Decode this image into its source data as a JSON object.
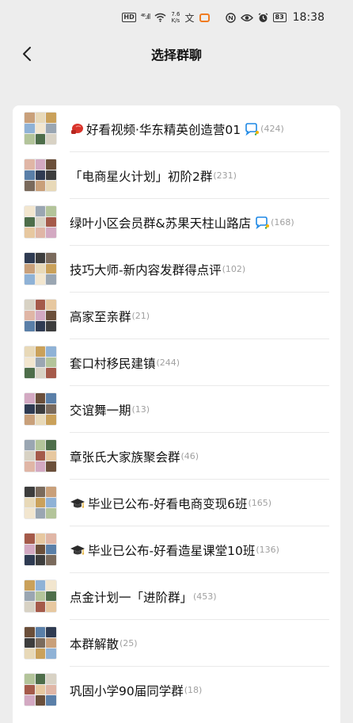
{
  "status_bar": {
    "hd": "HD",
    "signal": "⁴⁶.ıll",
    "speed_value": "7.6",
    "speed_unit": "K/s",
    "battery": "83",
    "time": "18:38"
  },
  "header": {
    "title": "选择群聊",
    "back_icon": "chevron-left-icon"
  },
  "groups": [
    {
      "name": "好看视频·华东精英创造营01",
      "count": "(424)",
      "prefix_icon": "boxing-glove-icon",
      "suffix_icon": "chat-bubble-icon"
    },
    {
      "name": "「电商星火计划」初阶2群",
      "count": "(231)"
    },
    {
      "name": "绿叶小区会员群&苏果天柱山路店",
      "count": "(168)",
      "suffix_icon": "chat-bubble-icon"
    },
    {
      "name": "技巧大师-新内容发群得点评",
      "count": "(102)"
    },
    {
      "name": "高家至亲群",
      "count": "(21)"
    },
    {
      "name": "套口村移民建镇",
      "count": "(244)"
    },
    {
      "name": "交谊舞一期",
      "count": "(13)"
    },
    {
      "name": "章张氏大家族聚会群",
      "count": "(46)"
    },
    {
      "name": "毕业已公布-好看电商变现6班",
      "count": "(165)",
      "prefix_icon": "graduation-cap-icon"
    },
    {
      "name": "毕业已公布-好看造星课堂10班",
      "count": "(136)",
      "prefix_icon": "graduation-cap-icon"
    },
    {
      "name": "点金计划一「进阶群」",
      "count": "(453)"
    },
    {
      "name": "本群解散",
      "count": "(25)"
    },
    {
      "name": "巩固小学90届同学群",
      "count": "(18)"
    }
  ],
  "colors": {
    "background": "#ededed",
    "card": "#ffffff",
    "count_text": "#a0a0a0",
    "bubble_accent": "#1e88e5"
  }
}
